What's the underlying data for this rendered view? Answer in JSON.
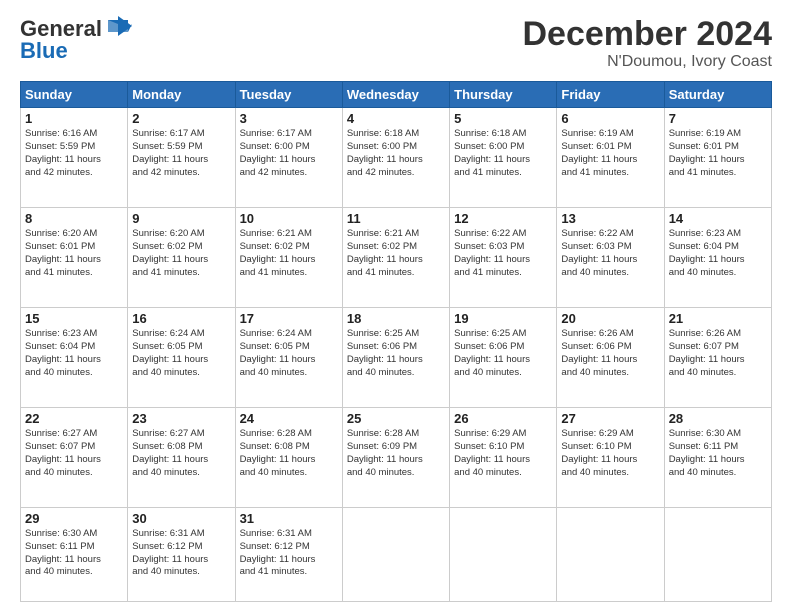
{
  "logo": {
    "line1": "General",
    "line2": "Blue"
  },
  "title": "December 2024",
  "subtitle": "N'Doumou, Ivory Coast",
  "days_of_week": [
    "Sunday",
    "Monday",
    "Tuesday",
    "Wednesday",
    "Thursday",
    "Friday",
    "Saturday"
  ],
  "weeks": [
    [
      {
        "day": "1",
        "sunrise": "6:16 AM",
        "sunset": "5:59 PM",
        "daylight": "11 hours and 42 minutes."
      },
      {
        "day": "2",
        "sunrise": "6:17 AM",
        "sunset": "5:59 PM",
        "daylight": "11 hours and 42 minutes."
      },
      {
        "day": "3",
        "sunrise": "6:17 AM",
        "sunset": "6:00 PM",
        "daylight": "11 hours and 42 minutes."
      },
      {
        "day": "4",
        "sunrise": "6:18 AM",
        "sunset": "6:00 PM",
        "daylight": "11 hours and 42 minutes."
      },
      {
        "day": "5",
        "sunrise": "6:18 AM",
        "sunset": "6:00 PM",
        "daylight": "11 hours and 41 minutes."
      },
      {
        "day": "6",
        "sunrise": "6:19 AM",
        "sunset": "6:01 PM",
        "daylight": "11 hours and 41 minutes."
      },
      {
        "day": "7",
        "sunrise": "6:19 AM",
        "sunset": "6:01 PM",
        "daylight": "11 hours and 41 minutes."
      }
    ],
    [
      {
        "day": "8",
        "sunrise": "6:20 AM",
        "sunset": "6:01 PM",
        "daylight": "11 hours and 41 minutes."
      },
      {
        "day": "9",
        "sunrise": "6:20 AM",
        "sunset": "6:02 PM",
        "daylight": "11 hours and 41 minutes."
      },
      {
        "day": "10",
        "sunrise": "6:21 AM",
        "sunset": "6:02 PM",
        "daylight": "11 hours and 41 minutes."
      },
      {
        "day": "11",
        "sunrise": "6:21 AM",
        "sunset": "6:02 PM",
        "daylight": "11 hours and 41 minutes."
      },
      {
        "day": "12",
        "sunrise": "6:22 AM",
        "sunset": "6:03 PM",
        "daylight": "11 hours and 41 minutes."
      },
      {
        "day": "13",
        "sunrise": "6:22 AM",
        "sunset": "6:03 PM",
        "daylight": "11 hours and 40 minutes."
      },
      {
        "day": "14",
        "sunrise": "6:23 AM",
        "sunset": "6:04 PM",
        "daylight": "11 hours and 40 minutes."
      }
    ],
    [
      {
        "day": "15",
        "sunrise": "6:23 AM",
        "sunset": "6:04 PM",
        "daylight": "11 hours and 40 minutes."
      },
      {
        "day": "16",
        "sunrise": "6:24 AM",
        "sunset": "6:05 PM",
        "daylight": "11 hours and 40 minutes."
      },
      {
        "day": "17",
        "sunrise": "6:24 AM",
        "sunset": "6:05 PM",
        "daylight": "11 hours and 40 minutes."
      },
      {
        "day": "18",
        "sunrise": "6:25 AM",
        "sunset": "6:06 PM",
        "daylight": "11 hours and 40 minutes."
      },
      {
        "day": "19",
        "sunrise": "6:25 AM",
        "sunset": "6:06 PM",
        "daylight": "11 hours and 40 minutes."
      },
      {
        "day": "20",
        "sunrise": "6:26 AM",
        "sunset": "6:06 PM",
        "daylight": "11 hours and 40 minutes."
      },
      {
        "day": "21",
        "sunrise": "6:26 AM",
        "sunset": "6:07 PM",
        "daylight": "11 hours and 40 minutes."
      }
    ],
    [
      {
        "day": "22",
        "sunrise": "6:27 AM",
        "sunset": "6:07 PM",
        "daylight": "11 hours and 40 minutes."
      },
      {
        "day": "23",
        "sunrise": "6:27 AM",
        "sunset": "6:08 PM",
        "daylight": "11 hours and 40 minutes."
      },
      {
        "day": "24",
        "sunrise": "6:28 AM",
        "sunset": "6:08 PM",
        "daylight": "11 hours and 40 minutes."
      },
      {
        "day": "25",
        "sunrise": "6:28 AM",
        "sunset": "6:09 PM",
        "daylight": "11 hours and 40 minutes."
      },
      {
        "day": "26",
        "sunrise": "6:29 AM",
        "sunset": "6:10 PM",
        "daylight": "11 hours and 40 minutes."
      },
      {
        "day": "27",
        "sunrise": "6:29 AM",
        "sunset": "6:10 PM",
        "daylight": "11 hours and 40 minutes."
      },
      {
        "day": "28",
        "sunrise": "6:30 AM",
        "sunset": "6:11 PM",
        "daylight": "11 hours and 40 minutes."
      }
    ],
    [
      {
        "day": "29",
        "sunrise": "6:30 AM",
        "sunset": "6:11 PM",
        "daylight": "11 hours and 40 minutes."
      },
      {
        "day": "30",
        "sunrise": "6:31 AM",
        "sunset": "6:12 PM",
        "daylight": "11 hours and 40 minutes."
      },
      {
        "day": "31",
        "sunrise": "6:31 AM",
        "sunset": "6:12 PM",
        "daylight": "11 hours and 41 minutes."
      },
      null,
      null,
      null,
      null
    ]
  ]
}
